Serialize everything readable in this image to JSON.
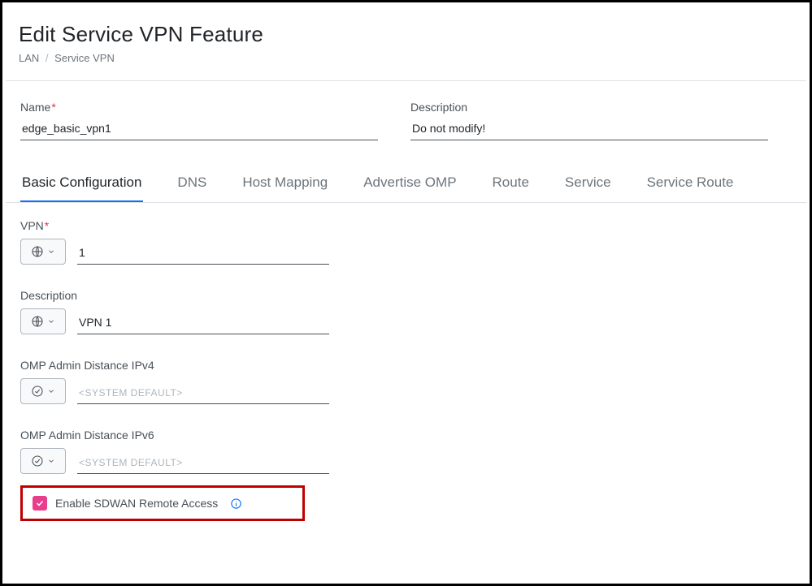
{
  "header": {
    "title": "Edit Service VPN Feature",
    "breadcrumb": {
      "parent": "LAN",
      "current": "Service VPN"
    }
  },
  "top_form": {
    "name_label": "Name",
    "name_value": "edge_basic_vpn1",
    "description_label": "Description",
    "description_value": "Do not modify!"
  },
  "tabs": {
    "t0": "Basic Configuration",
    "t1": "DNS",
    "t2": "Host Mapping",
    "t3": "Advertise OMP",
    "t4": "Route",
    "t5": "Service",
    "t6": "Service Route"
  },
  "fields": {
    "vpn_label": "VPN",
    "vpn_value": "1",
    "desc_label": "Description",
    "desc_value": "VPN 1",
    "omp4_label": "OMP Admin Distance IPv4",
    "omp4_value": "<SYSTEM DEFAULT>",
    "omp6_label": "OMP Admin Distance IPv6",
    "omp6_value": "<SYSTEM DEFAULT>",
    "enable_ra_label": "Enable SDWAN Remote Access"
  }
}
